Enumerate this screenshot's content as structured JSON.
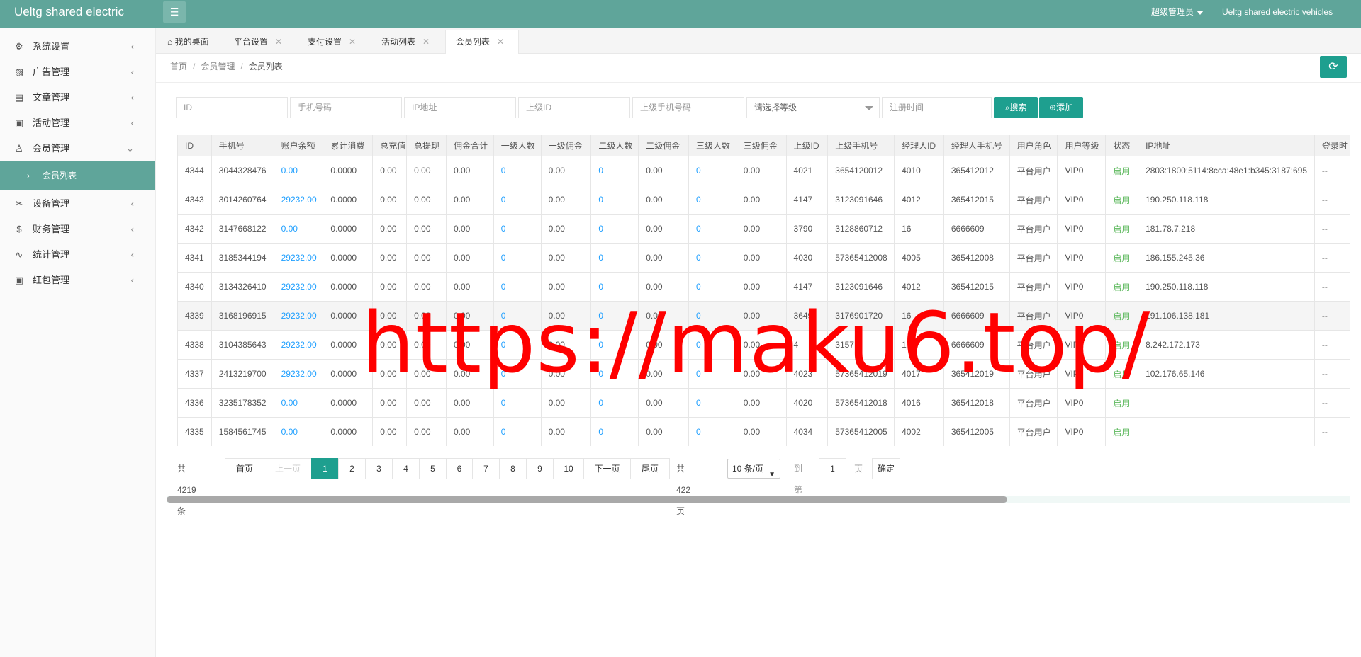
{
  "app": {
    "title": "Ueltg shared electric",
    "menu_icon": "hamburger-icon"
  },
  "header": {
    "user_label": "超级管理员",
    "brand_label": "Ueltg shared electric vehicles"
  },
  "sidebar": {
    "items": [
      {
        "label": "系统设置",
        "icon": "⚙"
      },
      {
        "label": "广告管理",
        "icon": "▨"
      },
      {
        "label": "文章管理",
        "icon": "▤"
      },
      {
        "label": "活动管理",
        "icon": "▣"
      },
      {
        "label": "会员管理",
        "icon": "♙"
      },
      {
        "label": "设备管理",
        "icon": "✂"
      },
      {
        "label": "财务管理",
        "icon": "$"
      },
      {
        "label": "统计管理",
        "icon": "∿"
      },
      {
        "label": "红包管理",
        "icon": "▣"
      }
    ],
    "active_sub": "会员列表",
    "collapsed_arrow": "‹",
    "expanded_arrow": "⌄",
    "sub_arrow": "›"
  },
  "tabs": [
    {
      "label": "我的桌面",
      "icon": "⌂"
    },
    {
      "label": "平台设置"
    },
    {
      "label": "支付设置"
    },
    {
      "label": "活动列表"
    },
    {
      "label": "会员列表"
    }
  ],
  "tab_close": "✕",
  "breadcrumb": {
    "home": "首页",
    "sep": "/",
    "section": "会员管理",
    "current": "会员列表"
  },
  "refresh_icon": "⟳",
  "search": {
    "id_ph": "ID",
    "phone_ph": "手机号码",
    "ip_ph": "IP地址",
    "parent_id_ph": "上级ID",
    "parent_phone_ph": "上级手机号码",
    "level_ph": "请选择等级",
    "reg_time_ph": "注册时间",
    "search_label": "搜索",
    "search_icon": "⌕",
    "add_label": "添加",
    "add_icon": "⊕"
  },
  "table": {
    "headers": [
      "ID",
      "手机号",
      "账户余额",
      "累计消费",
      "总充值",
      "总提现",
      "佣金合计",
      "一级人数",
      "一级佣金",
      "二级人数",
      "二级佣金",
      "三级人数",
      "三级佣金",
      "上级ID",
      "上级手机号",
      "经理人ID",
      "经理人手机号",
      "用户角色",
      "用户等级",
      "状态",
      "IP地址",
      "登录时"
    ],
    "rows": [
      [
        "4344",
        "3044328476",
        "0.00",
        "0.0000",
        "0.00",
        "0.00",
        "0.00",
        "0",
        "0.00",
        "0",
        "0.00",
        "0",
        "0.00",
        "4021",
        "3654120012",
        "4010",
        "365412012",
        "平台用户",
        "VIP0",
        "启用",
        "2803:1800:5114:8cca:48e1:b345:3187:695",
        "--"
      ],
      [
        "4343",
        "3014260764",
        "29232.00",
        "0.0000",
        "0.00",
        "0.00",
        "0.00",
        "0",
        "0.00",
        "0",
        "0.00",
        "0",
        "0.00",
        "4147",
        "3123091646",
        "4012",
        "365412015",
        "平台用户",
        "VIP0",
        "启用",
        "190.250.118.118",
        "--"
      ],
      [
        "4342",
        "3147668122",
        "0.00",
        "0.0000",
        "0.00",
        "0.00",
        "0.00",
        "0",
        "0.00",
        "0",
        "0.00",
        "0",
        "0.00",
        "3790",
        "3128860712",
        "16",
        "6666609",
        "平台用户",
        "VIP0",
        "启用",
        "181.78.7.218",
        "--"
      ],
      [
        "4341",
        "3185344194",
        "29232.00",
        "0.0000",
        "0.00",
        "0.00",
        "0.00",
        "0",
        "0.00",
        "0",
        "0.00",
        "0",
        "0.00",
        "4030",
        "57365412008",
        "4005",
        "365412008",
        "平台用户",
        "VIP0",
        "启用",
        "186.155.245.36",
        "--"
      ],
      [
        "4340",
        "3134326410",
        "29232.00",
        "0.0000",
        "0.00",
        "0.00",
        "0.00",
        "0",
        "0.00",
        "0",
        "0.00",
        "0",
        "0.00",
        "4147",
        "3123091646",
        "4012",
        "365412015",
        "平台用户",
        "VIP0",
        "启用",
        "190.250.118.118",
        "--"
      ],
      [
        "4339",
        "3168196915",
        "29232.00",
        "0.0000",
        "0.00",
        "0.00",
        "0.00",
        "0",
        "0.00",
        "0",
        "0.00",
        "0",
        "0.00",
        "3649",
        "3176901720",
        "16",
        "6666609",
        "平台用户",
        "VIP0",
        "启用",
        "191.106.138.181",
        "--"
      ],
      [
        "4338",
        "3104385643",
        "29232.00",
        "0.0000",
        "0.00",
        "0.00",
        "0.00",
        "0",
        "0.00",
        "0",
        "0.00",
        "0",
        "0.00",
        "4",
        "3157",
        "1",
        "6666609",
        "平台用户",
        "VIP0",
        "启用",
        "8.242.172.173",
        "--"
      ],
      [
        "4337",
        "2413219700",
        "29232.00",
        "0.0000",
        "0.00",
        "0.00",
        "0.00",
        "0",
        "0.00",
        "0",
        "0.00",
        "0",
        "0.00",
        "4023",
        "57365412019",
        "4017",
        "365412019",
        "平台用户",
        "VIP0",
        "启用",
        "102.176.65.146",
        "--"
      ],
      [
        "4336",
        "3235178352",
        "0.00",
        "0.0000",
        "0.00",
        "0.00",
        "0.00",
        "0",
        "0.00",
        "0",
        "0.00",
        "0",
        "0.00",
        "4020",
        "57365412018",
        "4016",
        "365412018",
        "平台用户",
        "VIP0",
        "启用",
        "",
        "--"
      ],
      [
        "4335",
        "1584561745",
        "0.00",
        "0.0000",
        "0.00",
        "0.00",
        "0.00",
        "0",
        "0.00",
        "0",
        "0.00",
        "0",
        "0.00",
        "4034",
        "57365412005",
        "4002",
        "365412005",
        "平台用户",
        "VIP0",
        "启用",
        "",
        "--"
      ]
    ]
  },
  "pager": {
    "total": "共 4219 条",
    "first": "首页",
    "prev": "上一页",
    "pages": [
      "1",
      "2",
      "3",
      "4",
      "5",
      "6",
      "7",
      "8",
      "9",
      "10"
    ],
    "next": "下一页",
    "last": "尾页",
    "total_pages": "共 422 页",
    "per_page": "10 条/页",
    "goto_label": "到第",
    "goto_value": "1",
    "page_unit": "页",
    "confirm": "确定"
  },
  "scroll": {
    "position": 0.71
  },
  "watermark": "https://maku6.top/",
  "colors": {
    "primary": "#1e9f8f",
    "header": "#5fa59a",
    "link": "#1e9fff",
    "status": "#5cb85c",
    "watermark": "#ff0000"
  }
}
